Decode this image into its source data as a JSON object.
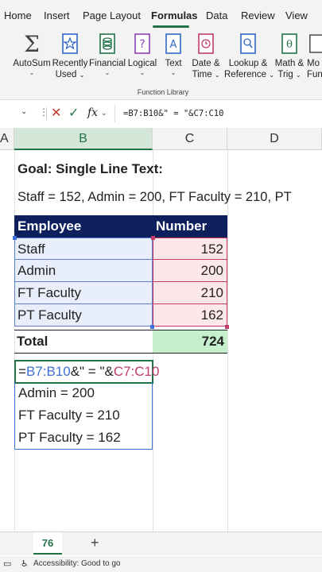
{
  "ribbon_tabs": [
    "Home",
    "Insert",
    "Page Layout",
    "Formulas",
    "Data",
    "Review",
    "View"
  ],
  "active_tab": "Formulas",
  "ribbon_buttons": [
    {
      "line1": "AutoSum",
      "line2": ""
    },
    {
      "line1": "Recently",
      "line2": "Used"
    },
    {
      "line1": "Financial",
      "line2": ""
    },
    {
      "line1": "Logical",
      "line2": ""
    },
    {
      "line1": "Text",
      "line2": ""
    },
    {
      "line1": "Date &",
      "line2": "Time"
    },
    {
      "line1": "Lookup &",
      "line2": "Reference"
    },
    {
      "line1": "Math &",
      "line2": "Trig"
    },
    {
      "line1": "Mo",
      "line2": "Fun"
    }
  ],
  "group_label": "Function Library",
  "formula_bar": {
    "fx": "fx",
    "text": "=B7:B10&\" = \"&C7:C10"
  },
  "columns": [
    "A",
    "B",
    "C",
    "D"
  ],
  "sheet": {
    "goal": "Goal: Single Line Text:",
    "line_text": "Staff = 152, Admin = 200, FT Faculty = 210, PT",
    "header": {
      "employee": "Employee",
      "number": "Number"
    },
    "rows": [
      {
        "name": "Staff",
        "value": "152"
      },
      {
        "name": "Admin",
        "value": "200"
      },
      {
        "name": "FT Faculty",
        "value": "210"
      },
      {
        "name": "PT Faculty",
        "value": "162"
      }
    ],
    "total": {
      "label": "Total",
      "value": "724"
    },
    "edit": {
      "eq": "=",
      "ref1": "B7:B10",
      "mid": "&\" = \"&",
      "ref2": "C7:C10"
    },
    "spill": [
      "Admin = 200",
      "FT Faculty = 210",
      "PT Faculty = 162"
    ]
  },
  "sheet_tab": "76",
  "add_sheet": "+",
  "status": "Accessibility: Good to go",
  "colors": {
    "excel_green": "#217346",
    "header_navy": "#0d1f5c",
    "ref_blue": "#3f6fd9",
    "ref_pink": "#c23c6a",
    "total_green": "#c6efce"
  }
}
